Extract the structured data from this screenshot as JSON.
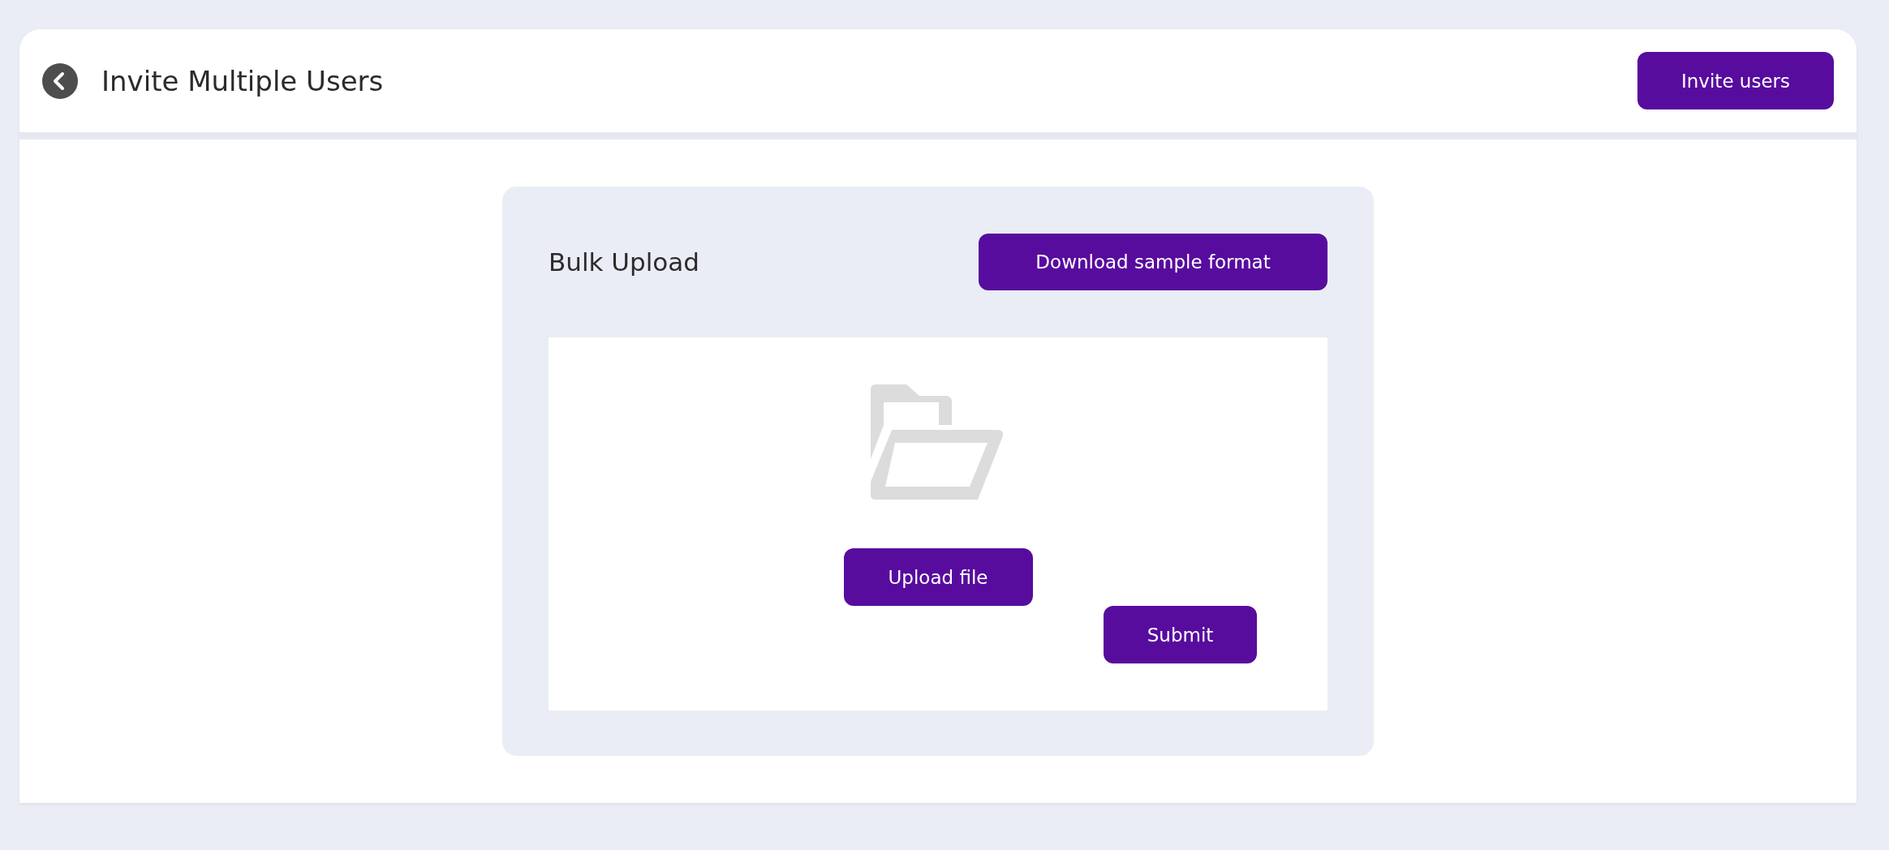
{
  "header": {
    "title": "Invite Multiple Users",
    "action": "Invite users"
  },
  "bulk_upload": {
    "title": "Bulk Upload",
    "download_button": "Download sample format",
    "upload_button": "Upload file",
    "submit_button": "Submit"
  }
}
